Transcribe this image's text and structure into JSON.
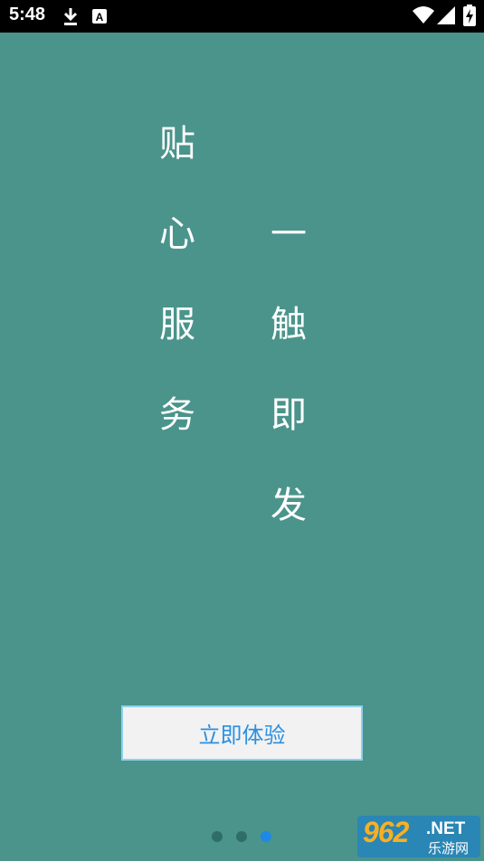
{
  "status_bar": {
    "time": "5:48",
    "icons": [
      "download-icon",
      "text-a-icon",
      "wifi-icon",
      "signal-icon",
      "battery-charging-icon"
    ]
  },
  "headline": {
    "left_column": [
      "贴",
      "心",
      "服",
      "务"
    ],
    "right_column": [
      "一",
      "触",
      "即",
      "发"
    ]
  },
  "cta": {
    "label": "立即体验"
  },
  "pager": {
    "count": 3,
    "active_index": 2
  },
  "watermark": {
    "number": "962",
    "suffix": ".NET",
    "subtitle": "乐游网"
  },
  "colors": {
    "background": "#4a948b",
    "dot_inactive": "#2e6e66",
    "dot_active": "#1e88e5",
    "button_text": "#2a90e0",
    "button_border": "#8fd0ee"
  }
}
